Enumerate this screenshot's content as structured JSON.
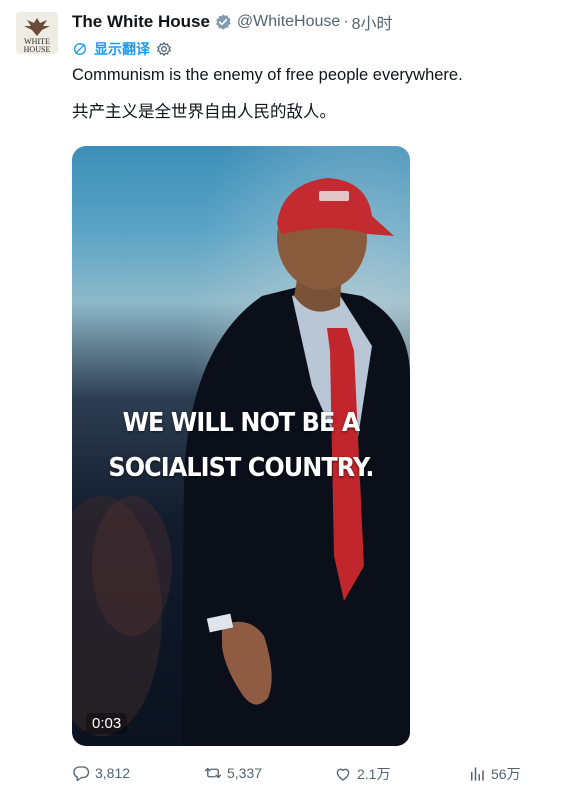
{
  "post": {
    "avatar_text": "WHITE HOUSE",
    "author_name": "The White House",
    "handle": "@WhiteHouse",
    "separator": "·",
    "time": "8小时",
    "translate_label": "显示翻译",
    "text_en": "Communism is the enemy of free people everywhere.",
    "text_zh": "共产主义是全世界自由人民的敌人。",
    "verified_color": "#829aab",
    "link_color": "#1d9bf0"
  },
  "media": {
    "caption_line1": "WE WILL NOT BE A",
    "caption_line2": "SOCIALIST COUNTRY.",
    "duration": "0:03"
  },
  "actions": {
    "replies": "3,812",
    "reposts": "5,337",
    "likes": "2.1万",
    "views": "56万",
    "icons": [
      "reply-icon",
      "repost-icon",
      "like-icon",
      "views-icon"
    ]
  }
}
